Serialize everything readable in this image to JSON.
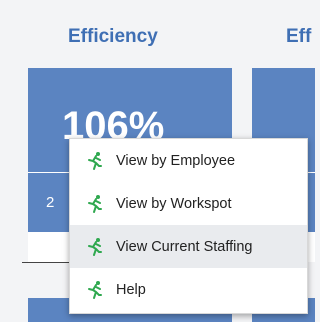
{
  "columns": [
    {
      "title": "Efficiency"
    },
    {
      "title": "Eff"
    }
  ],
  "tile": {
    "value": "106%",
    "sub_value": "2"
  },
  "context_menu": {
    "items": [
      {
        "label": "View by Employee",
        "icon": "running-person-icon"
      },
      {
        "label": "View by Workspot",
        "icon": "running-person-icon"
      },
      {
        "label": "View Current Staffing",
        "icon": "running-person-icon"
      },
      {
        "label": "Help",
        "icon": "running-person-icon"
      }
    ],
    "highlighted_index": 2
  },
  "colors": {
    "title": "#3f6fb4",
    "tile": "#5b84c1",
    "icon": "#2fa84f",
    "menu_hover": "#e9ebee"
  }
}
